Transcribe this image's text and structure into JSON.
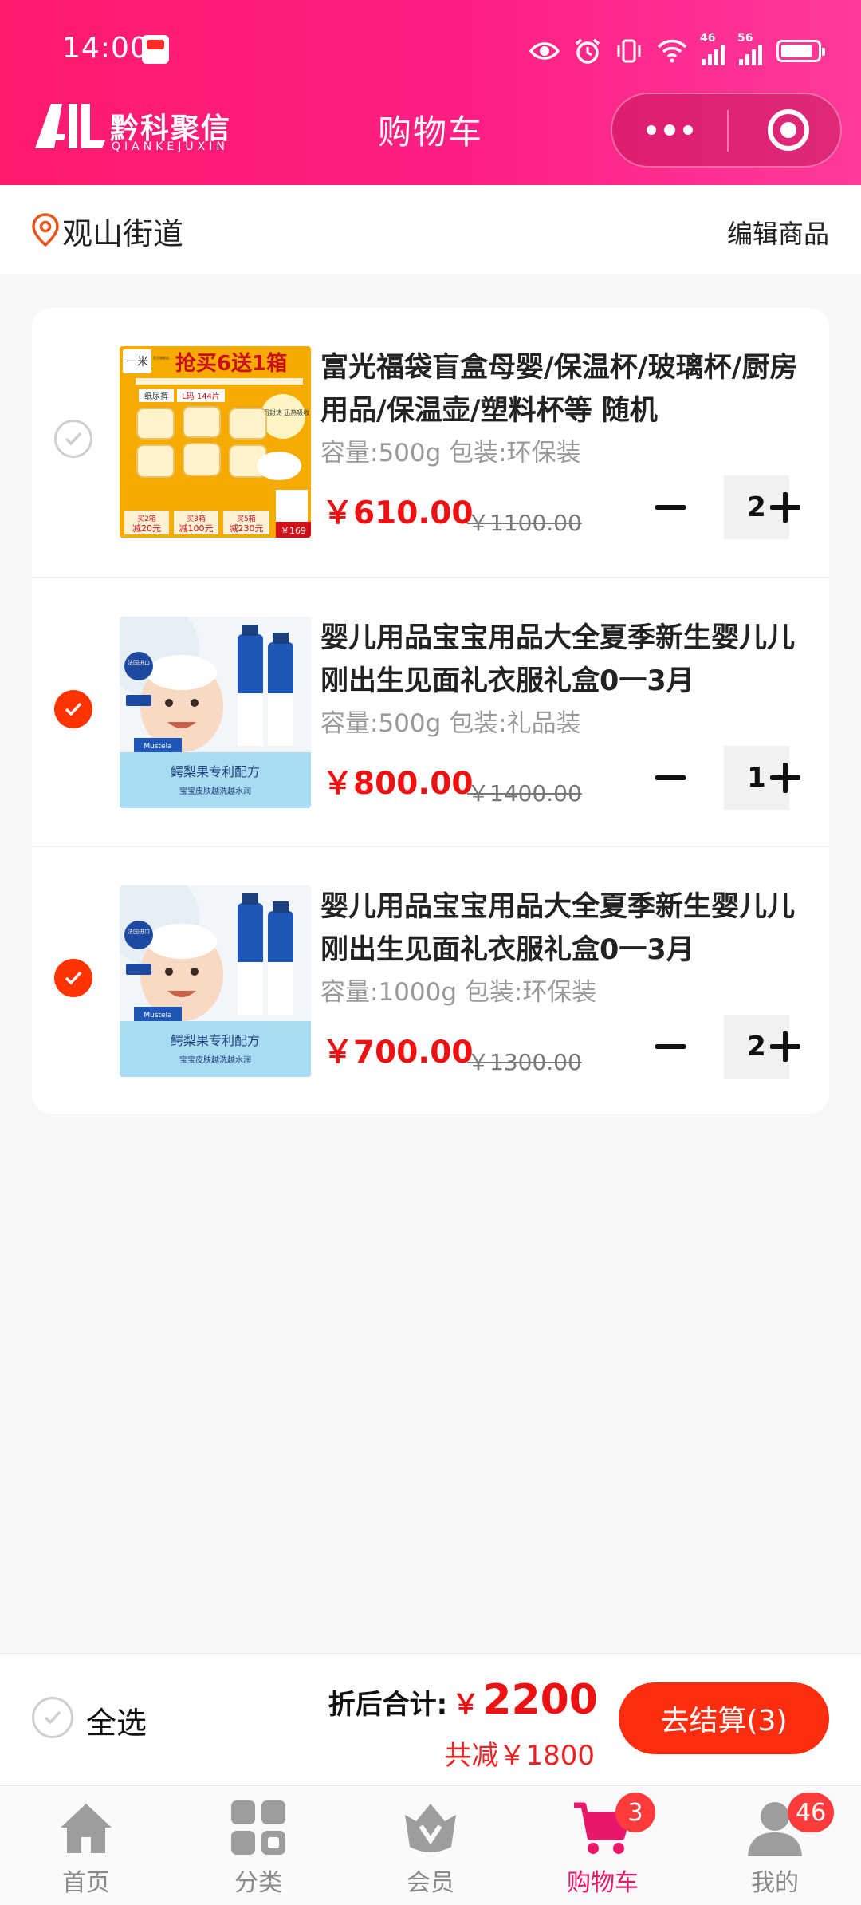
{
  "status_bar": {
    "time": "14:00",
    "network_1": "46",
    "network_2": "56",
    "icons": [
      "notification-app-icon",
      "eye-icon",
      "alarm-icon",
      "vibrate-icon",
      "wifi-icon",
      "signal-icon",
      "signal-icon",
      "battery-icon"
    ]
  },
  "header": {
    "logo_text": "黔科聚信",
    "logo_subtext": "QIANKEJUXIN",
    "title": "购物车",
    "capsule_icons": [
      "more-icon",
      "close-target-icon"
    ]
  },
  "location": {
    "address": "观山街道",
    "edit_label": "编辑商品"
  },
  "cart_items": [
    {
      "checked": false,
      "title": "富光福袋盲盒母婴/保温杯/玻璃杯/厨房用品/保温壶/塑料杯等 随机",
      "spec": "容量:500g 包装:环保装",
      "price": "￥610.00",
      "original_price": "￥1100.00",
      "quantity": "2",
      "thumb": {
        "banner": "抢买6送1箱",
        "sub": "官方旗舰店",
        "tag1": "纸尿裤",
        "tag2": "L码 144片",
        "seal": "全面封涛 迅热吸收",
        "deal1_top": "买2箱",
        "deal1_bot": "减20元",
        "deal2_top": "买3箱",
        "deal2_bot": "减100元",
        "deal3_top": "买5箱",
        "deal3_bot": "减230元",
        "price_tag": "￥169"
      }
    },
    {
      "checked": true,
      "title": "婴儿用品宝宝用品大全夏季新生婴儿儿刚出生见面礼衣服礼盒0一3月",
      "spec": "容量:500g 包装:礼品装",
      "price": "￥800.00",
      "original_price": "￥1400.00",
      "quantity": "1",
      "thumb": {
        "badge": "法国进口",
        "brand": "Mustela",
        "caption": "鳄梨果专利配方",
        "sub_caption": "宝宝皮肤越洗越水润"
      }
    },
    {
      "checked": true,
      "title": "婴儿用品宝宝用品大全夏季新生婴儿儿刚出生见面礼衣服礼盒0一3月",
      "spec": "容量:1000g 包装:环保装",
      "price": "￥700.00",
      "original_price": "￥1300.00",
      "quantity": "2",
      "thumb": {
        "badge": "法国进口",
        "brand": "Mustela",
        "caption": "鳄梨果专利配方",
        "sub_caption": "宝宝皮肤越洗越水润"
      }
    }
  ],
  "checkout": {
    "select_all_label": "全选",
    "total_label": "折后合计:",
    "total_currency": "￥",
    "total_value": "2200",
    "saving": "共减￥1800",
    "pay_button": "去结算(3)"
  },
  "tabbar": {
    "tabs": [
      {
        "label": "首页",
        "icon": "home-icon"
      },
      {
        "label": "分类",
        "icon": "category-grid-icon"
      },
      {
        "label": "会员",
        "icon": "vip-crown-icon"
      },
      {
        "label": "购物车",
        "icon": "cart-icon",
        "badge": "3",
        "active": true
      },
      {
        "label": "我的",
        "icon": "user-icon",
        "badge": "46"
      }
    ]
  },
  "colors": {
    "header_gradient_start": "#ff1a6e",
    "header_gradient_end": "#ff3a9a",
    "price_red": "#ee1111",
    "check_on": "#ff3300",
    "pay_button": "#ff2d10",
    "tab_active": "#e8176a"
  }
}
